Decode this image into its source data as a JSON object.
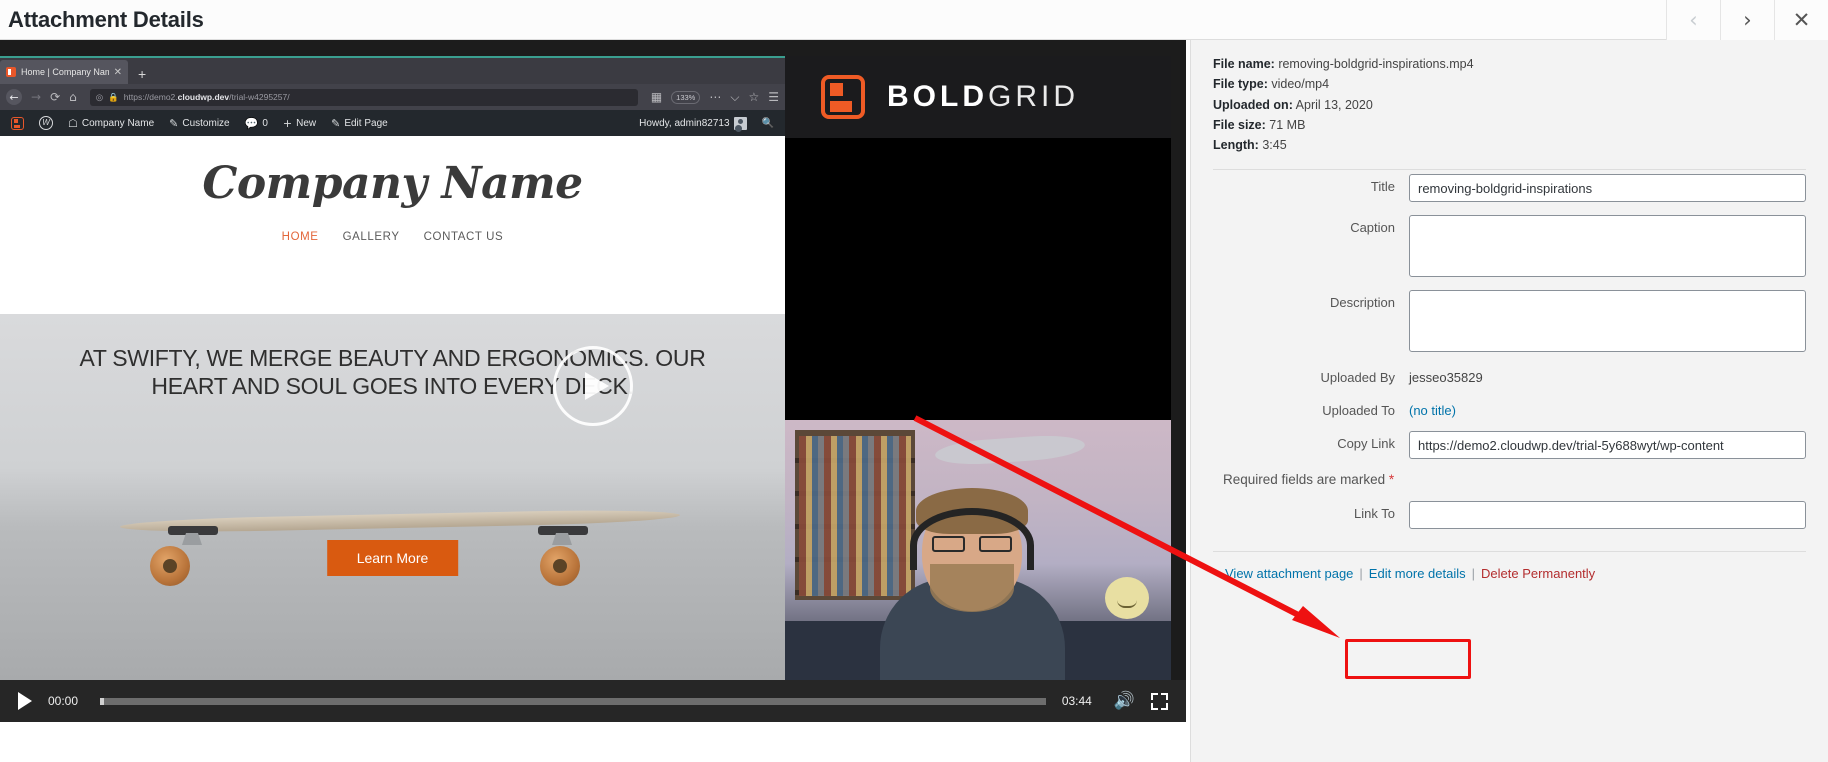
{
  "header": {
    "title": "Attachment Details",
    "prev_icon": "chevron-left-icon",
    "next_icon": "chevron-right-icon",
    "close_icon": "close-icon"
  },
  "browser": {
    "tab_title": "Home | Company Name",
    "new_tab_label": "+",
    "url_prefix": "https://demo2.",
    "url_domain": "cloudwp.dev",
    "url_path": "/trial-w4295257/",
    "zoom_level": "133%",
    "back_icon": "back-arrow-icon",
    "forward_icon": "forward-arrow-icon",
    "reload_icon": "reload-icon",
    "home_icon": "home-icon",
    "shield_icon": "shield-icon",
    "lock_icon": "lock-icon",
    "reader_icon": "reader-view-icon",
    "more_icon": "more-options-icon",
    "pocket_icon": "pocket-icon",
    "bookmark_icon": "bookmark-star-icon"
  },
  "admin_bar": {
    "boldgrid_icon": "boldgrid-logo-icon",
    "wp_icon": "wordpress-logo-icon",
    "site_name": "Company Name",
    "customize": "Customize",
    "comments_count": "0",
    "new": "New",
    "edit_page": "Edit Page",
    "howdy": "Howdy, admin82713",
    "avatar": "avatar-icon",
    "search_icon": "search-icon"
  },
  "site": {
    "title": "Company Name",
    "nav": [
      {
        "label": "HOME",
        "active": true
      },
      {
        "label": "GALLERY",
        "active": false
      },
      {
        "label": "CONTACT US",
        "active": false
      }
    ],
    "hero_heading": "AT SWIFTY, WE MERGE BEAUTY AND ERGONOMICS. OUR HEART AND SOUL GOES INTO EVERY DECK.",
    "cta_label": "Learn More",
    "play_overlay_icon": "play-button-icon"
  },
  "boldgrid": {
    "logo_icon": "boldgrid-mark-icon",
    "word_bold": "BOLD",
    "word_thin": "GRID"
  },
  "player": {
    "play_icon": "play-icon",
    "current_time": "00:00",
    "duration": "03:44",
    "volume_icon": "volume-icon",
    "fullscreen_icon": "fullscreen-icon",
    "progress_percent": 0
  },
  "details": {
    "meta": [
      {
        "label": "File name:",
        "value": "removing-boldgrid-inspirations.mp4"
      },
      {
        "label": "File type:",
        "value": "video/mp4"
      },
      {
        "label": "Uploaded on:",
        "value": "April 13, 2020"
      },
      {
        "label": "File size:",
        "value": "71 MB"
      },
      {
        "label": "Length:",
        "value": "3:45"
      }
    ],
    "fields": {
      "title_label": "Title",
      "title_value": "removing-boldgrid-inspirations",
      "caption_label": "Caption",
      "caption_value": "",
      "description_label": "Description",
      "description_value": "",
      "uploaded_by_label": "Uploaded By",
      "uploaded_by_value": "jesseo35829",
      "uploaded_to_label": "Uploaded To",
      "uploaded_to_value": "(no title)",
      "copy_link_label": "Copy Link",
      "copy_link_value": "https://demo2.cloudwp.dev/trial-5y688wyt/wp-content",
      "link_to_label": "Link To",
      "link_to_value": ""
    },
    "required_note": "Required fields are marked",
    "required_star": "*",
    "actions": {
      "view_attachment_page": "View attachment page",
      "divider": "|",
      "edit_more_details": "Edit more details",
      "delete_permanently": "Delete Permanently"
    }
  },
  "annotation": {
    "highlight_color": "#ee1111",
    "arrow_color": "#ee1111",
    "target": "edit-more-details-link"
  }
}
